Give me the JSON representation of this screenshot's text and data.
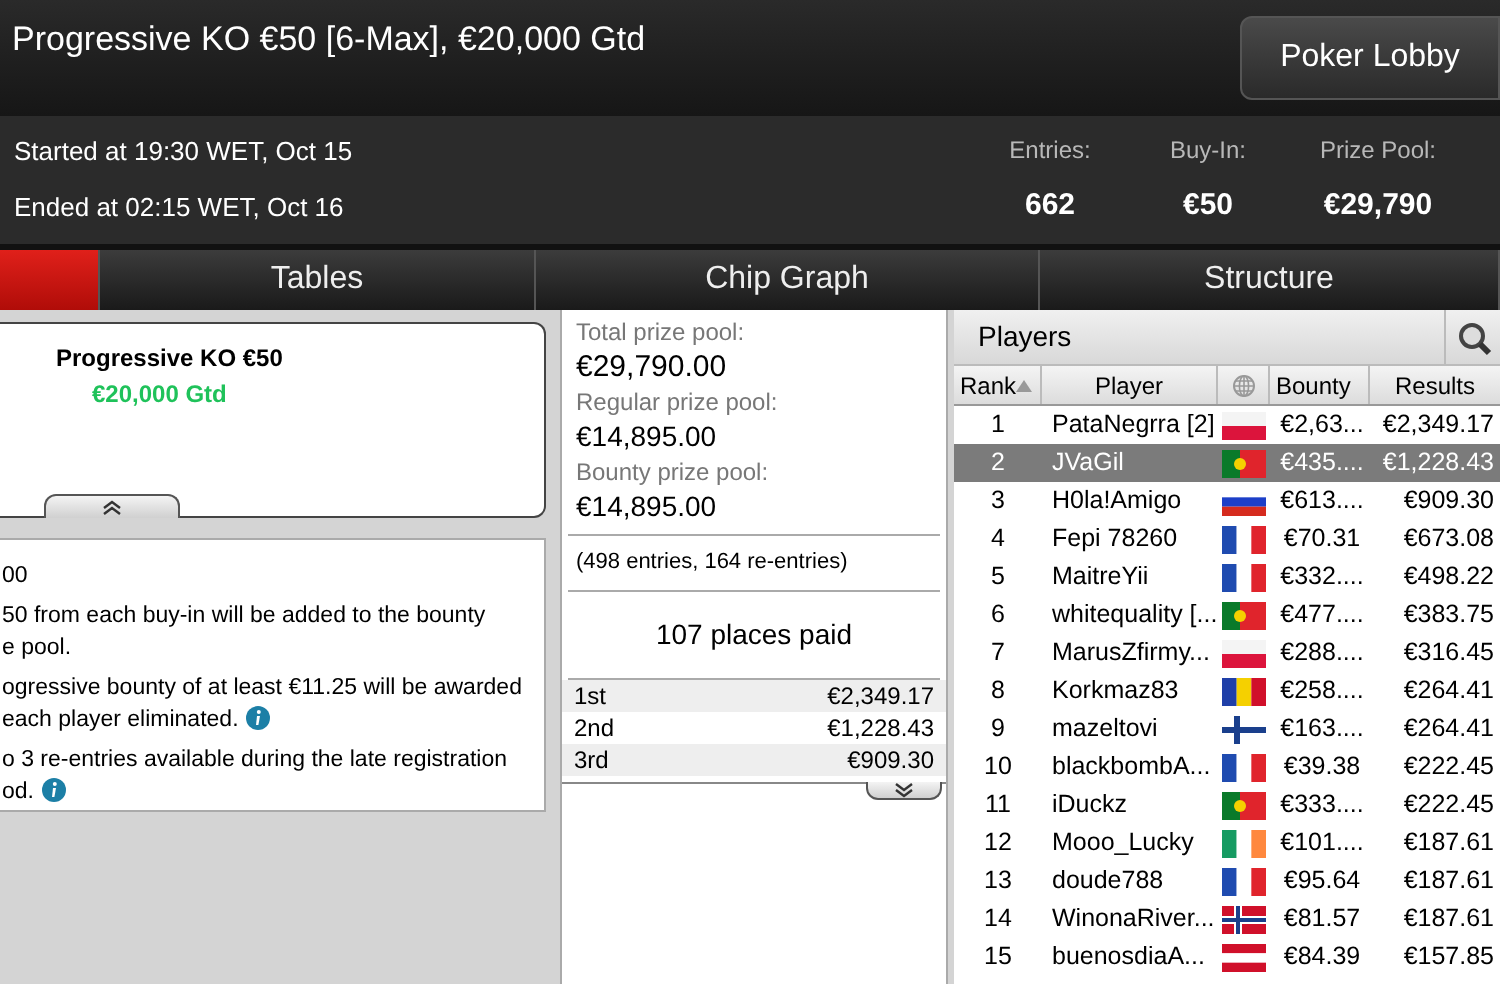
{
  "window": {
    "title": "Progressive KO €50 [6-Max], €20,000 Gtd"
  },
  "lobby_button": "Poker Lobby",
  "started": "Started at 19:30 WET, Oct 15",
  "ended": "Ended at 02:15 WET, Oct 16",
  "stats": [
    {
      "label": "Entries:",
      "value": "662"
    },
    {
      "label": "Buy-In:",
      "value": "€50"
    },
    {
      "label": "Prize Pool:",
      "value": "€29,790"
    }
  ],
  "tabs": [
    {
      "selected": true
    },
    {
      "label": "Tables",
      "selected": false
    },
    {
      "label": "Chip Graph",
      "selected": false
    },
    {
      "label": "Structure",
      "selected": false
    }
  ],
  "summary_card": {
    "name": "Progressive KO €50",
    "guarantee": "€20,000 Gtd"
  },
  "info": [
    {
      "lines": [
        "00"
      ],
      "info_icon": false
    },
    {
      "lines": [
        "50 from each buy-in will be added to the bounty",
        "e pool."
      ],
      "info_icon": false
    },
    {
      "lines": [
        "ogressive bounty of at least €11.25 will be awarded",
        "each player eliminated."
      ],
      "info_icon": true
    },
    {
      "lines": [
        "o 3 re-entries available during the late registration",
        "od."
      ],
      "info_icon": true
    }
  ],
  "prize_pools": [
    {
      "label": "Total prize pool:",
      "value": "€29,790.00"
    },
    {
      "label": "Regular prize pool:",
      "value": "€14,895.00"
    },
    {
      "label": "Bounty prize pool:",
      "value": "€14,895.00"
    }
  ],
  "entries_note": "(498 entries, 164 re-entries)",
  "places_paid": "107 places paid",
  "payouts": [
    {
      "place": "1st",
      "amount": "€2,349.17"
    },
    {
      "place": "2nd",
      "amount": "€1,228.43"
    },
    {
      "place": "3rd",
      "amount": "€909.30"
    }
  ],
  "players": {
    "title": "Players",
    "columns": [
      "Rank",
      "Player",
      "Bounty",
      "Results"
    ],
    "rows": [
      {
        "rank": "1",
        "name": "PataNegrra [2]",
        "bounty": "€2,63...",
        "result": "€2,349.17",
        "selected": false
      },
      {
        "rank": "2",
        "name": "JVaGil",
        "bounty": "€435....",
        "result": "€1,228.43",
        "selected": true
      },
      {
        "rank": "3",
        "name": "H0la!Amigo",
        "bounty": "€613....",
        "result": "€909.30",
        "selected": false
      },
      {
        "rank": "4",
        "name": "Fepi 78260",
        "bounty": "€70.31",
        "result": "€673.08",
        "selected": false
      },
      {
        "rank": "5",
        "name": "MaitreYii",
        "bounty": "€332....",
        "result": "€498.22",
        "selected": false
      },
      {
        "rank": "6",
        "name": "whitequality [...",
        "bounty": "€477....",
        "result": "€383.75",
        "selected": false
      },
      {
        "rank": "7",
        "name": "MarusZfirmy...",
        "bounty": "€288....",
        "result": "€316.45",
        "selected": false
      },
      {
        "rank": "8",
        "name": "Korkmaz83",
        "bounty": "€258....",
        "result": "€264.41",
        "selected": false
      },
      {
        "rank": "9",
        "name": "mazeltovi",
        "bounty": "€163....",
        "result": "€264.41",
        "selected": false
      },
      {
        "rank": "10",
        "name": "blackbombA...",
        "bounty": "€39.38",
        "result": "€222.45",
        "selected": false
      },
      {
        "rank": "11",
        "name": "iDuckz",
        "bounty": "€333....",
        "result": "€222.45",
        "selected": false
      },
      {
        "rank": "12",
        "name": "Mooo_Lucky",
        "bounty": "€101....",
        "result": "€187.61",
        "selected": false
      },
      {
        "rank": "13",
        "name": "doude788",
        "bounty": "€95.64",
        "result": "€187.61",
        "selected": false
      },
      {
        "rank": "14",
        "name": "WinonaRiver...",
        "bounty": "€81.57",
        "result": "€187.61",
        "selected": false
      },
      {
        "rank": "15",
        "name": "buenosdiaA...",
        "bounty": "€84.39",
        "result": "€157.85",
        "selected": false
      }
    ]
  }
}
